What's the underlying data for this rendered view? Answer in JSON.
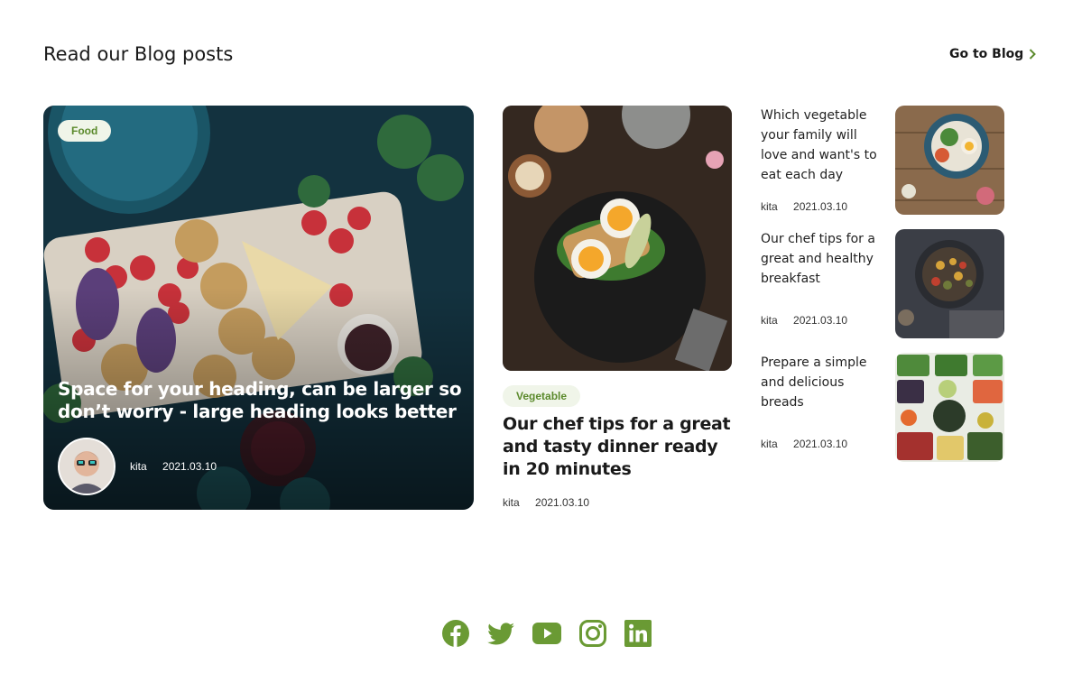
{
  "header": {
    "title": "Read our Blog posts",
    "link_label": "Go to Blog"
  },
  "featured": {
    "tag": "Food",
    "heading": "Space for your heading, can be larger so don’t worry - large heading looks better",
    "author": "kita",
    "date": "2021.03.10"
  },
  "middle": {
    "tag": "Vegetable",
    "heading": "Our chef tips for a great and tasty dinner ready in 20 minutes",
    "author": "kita",
    "date": "2021.03.10"
  },
  "side": [
    {
      "title": "Which vegetable your family will love and want's to eat each day",
      "author": "kita",
      "date": "2021.03.10"
    },
    {
      "title": "Our chef tips for a great and healthy breakfast",
      "author": "kita",
      "date": "2021.03.10"
    },
    {
      "title": "Prepare a simple and delicious breads",
      "author": "kita",
      "date": "2021.03.10"
    }
  ],
  "social": {
    "icons": [
      "facebook-icon",
      "twitter-icon",
      "youtube-icon",
      "instagram-icon",
      "linkedin-icon"
    ],
    "color": "#6a9a34"
  },
  "colors": {
    "accent": "#5b8a2c",
    "tag_bg": "#f0f5e9"
  }
}
